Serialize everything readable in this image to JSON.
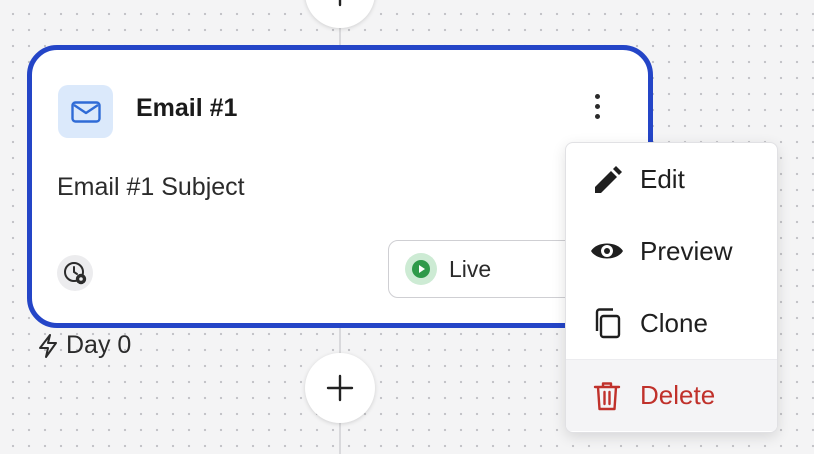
{
  "card": {
    "title": "Email #1",
    "subject": "Email #1 Subject",
    "status": "Live",
    "trigger_day": "Day 0"
  },
  "menu": {
    "edit": "Edit",
    "preview": "Preview",
    "clone": "Clone",
    "delete": "Delete"
  },
  "colors": {
    "card_border": "#2445c7",
    "icon_bg": "#dbe9fb",
    "live_green": "#2f9a4a",
    "delete_red": "#c0312b"
  },
  "icons": {
    "add": "plus-icon",
    "email": "envelope-icon",
    "more": "kebab-icon",
    "schedule": "clock-gear-icon",
    "live": "play-icon",
    "trigger": "lightning-icon",
    "edit": "pencil-icon",
    "preview": "eye-icon",
    "clone": "copy-icon",
    "delete": "trash-icon"
  }
}
